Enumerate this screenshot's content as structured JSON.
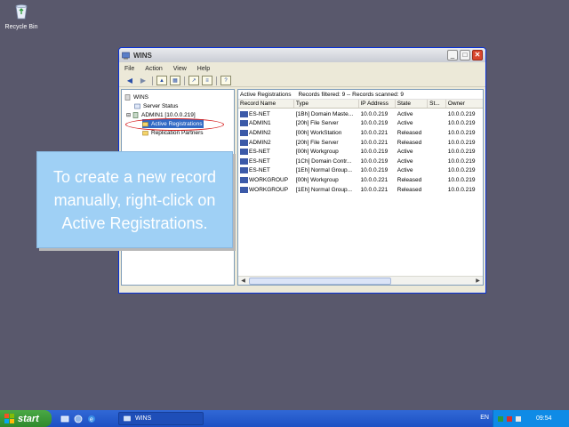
{
  "desktop": {
    "recycle_bin_label": "Recycle Bin"
  },
  "window": {
    "title": "WINS",
    "controls": {
      "minimize": "_",
      "maximize": "□",
      "close": "✕"
    }
  },
  "menu": [
    "File",
    "Action",
    "View",
    "Help"
  ],
  "toolbar": {
    "back_icon": "back-arrow-icon",
    "forward_icon": "forward-arrow-icon"
  },
  "tree": {
    "root": "WINS",
    "items": [
      "Server Status",
      "ADMIN1 [10.0.0.219]",
      "Active Registrations",
      "Replication Partners"
    ]
  },
  "list": {
    "header": {
      "title": "Active Registrations",
      "filtered": "Records filtered: 9 -- Records scanned: 9"
    },
    "columns": [
      "Record Name",
      "Type",
      "IP Address",
      "State",
      "St...",
      "Owner"
    ],
    "rows": [
      [
        "ES-NET",
        "[1Bh] Domain Maste...",
        "10.0.0.219",
        "Active",
        "10.0.0.219"
      ],
      [
        "ADMIN1",
        "[20h] File Server",
        "10.0.0.219",
        "Active",
        "10.0.0.219"
      ],
      [
        "ADMIN2",
        "[00h] WorkStation",
        "10.0.0.221",
        "Released",
        "10.0.0.219"
      ],
      [
        "ADMIN2",
        "[20h] File Server",
        "10.0.0.221",
        "Released",
        "10.0.0.219"
      ],
      [
        "ES-NET",
        "[00h] Workgroup",
        "10.0.0.219",
        "Active",
        "10.0.0.219"
      ],
      [
        "ES-NET",
        "[1Ch] Domain Contr...",
        "10.0.0.219",
        "Active",
        "10.0.0.219"
      ],
      [
        "ES-NET",
        "[1Eh] Normal Group...",
        "10.0.0.219",
        "Active",
        "10.0.0.219"
      ],
      [
        "WORKGROUP",
        "[00h] Workgroup",
        "10.0.0.221",
        "Released",
        "10.0.0.219"
      ],
      [
        "WORKGROUP",
        "[1Eh] Normal Group...",
        "10.0.0.221",
        "Released",
        "10.0.0.219"
      ]
    ]
  },
  "callout": {
    "text": "To create a new record manually, right-click on Active Registrations."
  },
  "taskbar": {
    "start_label": "start",
    "task_label": "WINS",
    "language": "EN",
    "clock": "09:54"
  },
  "colors": {
    "desktop": "#59586c",
    "accent": "#0831d9",
    "callout": "#9fd0f5",
    "highlight": "#d61e1e"
  }
}
